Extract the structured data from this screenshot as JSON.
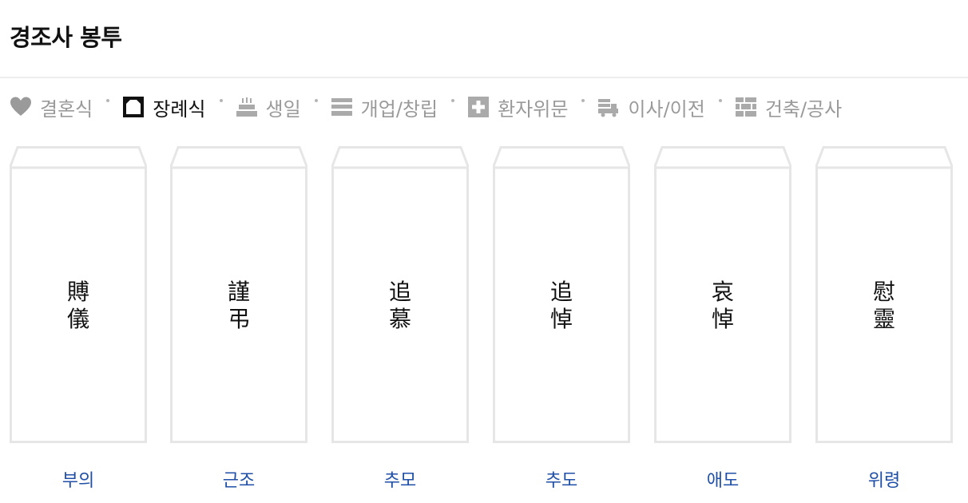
{
  "title": "경조사 봉투",
  "tabs": [
    {
      "label": "결혼식",
      "icon": "heart-icon",
      "active": false
    },
    {
      "label": "장례식",
      "icon": "frame-icon",
      "active": true
    },
    {
      "label": "생일",
      "icon": "cake-icon",
      "active": false
    },
    {
      "label": "개업/창립",
      "icon": "storefront-icon",
      "active": false
    },
    {
      "label": "환자위문",
      "icon": "medical-cross-icon",
      "active": false
    },
    {
      "label": "이사/이전",
      "icon": "moving-truck-icon",
      "active": false
    },
    {
      "label": "건축/공사",
      "icon": "brick-wall-icon",
      "active": false
    }
  ],
  "envelopes": [
    {
      "hanja": [
        "賻",
        "儀"
      ],
      "label": "부의"
    },
    {
      "hanja": [
        "謹",
        "弔"
      ],
      "label": "근조"
    },
    {
      "hanja": [
        "追",
        "慕"
      ],
      "label": "추모"
    },
    {
      "hanja": [
        "追",
        "悼"
      ],
      "label": "추도"
    },
    {
      "hanja": [
        "哀",
        "悼"
      ],
      "label": "애도"
    },
    {
      "hanja": [
        "慰",
        "靈"
      ],
      "label": "위령"
    }
  ],
  "colors": {
    "active_tab": "#111111",
    "inactive_tab": "#9a9a9a",
    "label_link": "#1f4fa6",
    "envelope_border": "#e6e6e6"
  }
}
